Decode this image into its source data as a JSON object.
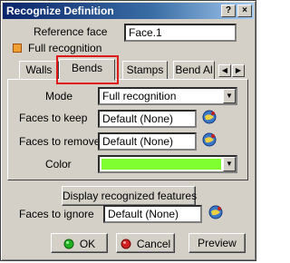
{
  "window": {
    "title": "Recognize Definition",
    "help_label": "?",
    "close_label": "×"
  },
  "reference_face": {
    "label": "Reference face",
    "value": "Face.1"
  },
  "full_recognition": {
    "label": "Full recognition",
    "checked": true
  },
  "tabs": [
    {
      "label": "Walls",
      "active": false
    },
    {
      "label": "Bends",
      "active": true
    },
    {
      "label": "Stamps",
      "active": false
    },
    {
      "label": "Bend Al",
      "active": false
    }
  ],
  "tab_scroll": {
    "left": "◀",
    "right": "▶"
  },
  "bends_panel": {
    "mode": {
      "label": "Mode",
      "value": "Full recognition"
    },
    "faces_to_keep": {
      "label": "Faces to keep",
      "value": "Default (None)"
    },
    "faces_to_remove": {
      "label": "Faces to remove",
      "value": "Default (None)"
    },
    "color": {
      "label": "Color",
      "value": "#80ff30"
    },
    "dropdown_arrow": "▼"
  },
  "display_button": {
    "label": "Display recognized features"
  },
  "faces_to_ignore": {
    "label": "Faces to ignore",
    "value": "Default (None)"
  },
  "buttons": {
    "ok": "OK",
    "cancel": "Cancel",
    "preview": "Preview"
  },
  "icons": {
    "picker": "face-picker-icon",
    "ok": "green-dot-icon",
    "cancel": "red-dot-icon"
  }
}
